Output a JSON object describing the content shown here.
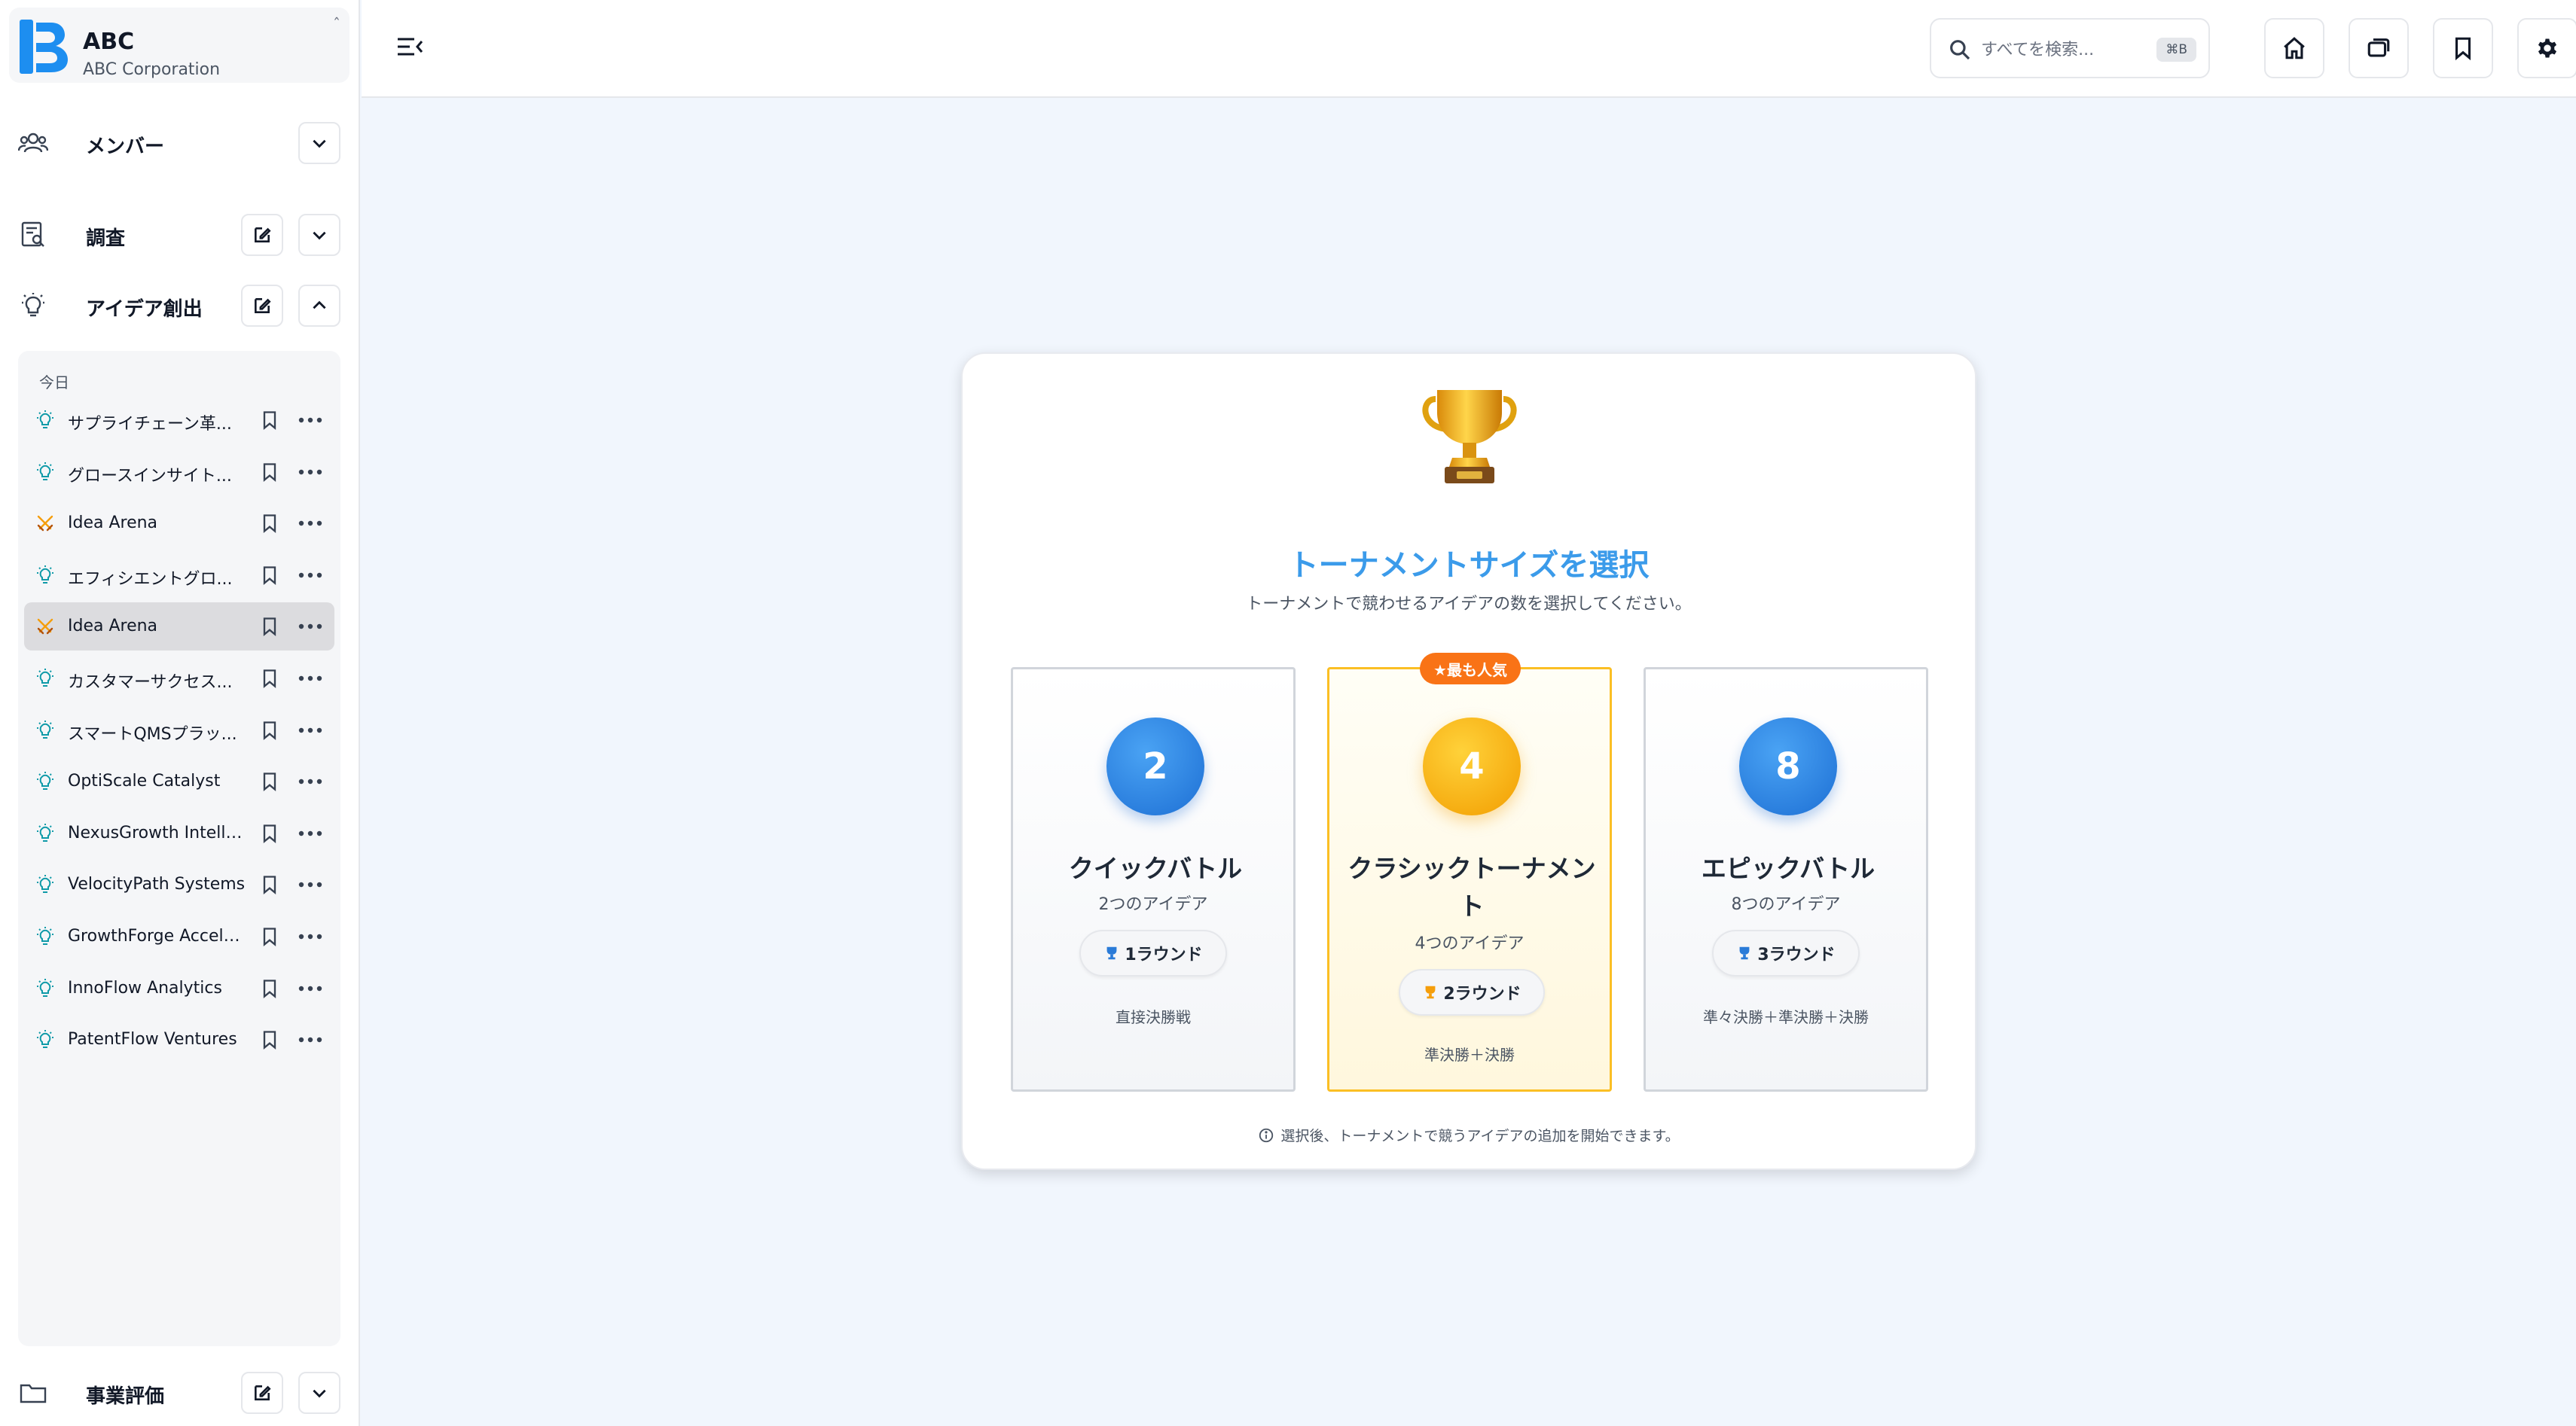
{
  "brand": {
    "name": "ABC",
    "subtitle": "ABC Corporation",
    "logo_letter": "B",
    "color": "#1d8ef0"
  },
  "nav": {
    "members": {
      "label": "メンバー"
    },
    "research": {
      "label": "調査"
    },
    "ideation": {
      "label": "アイデア創出"
    },
    "business_eval": {
      "label": "事業評価"
    }
  },
  "ideas": {
    "group_label": "今日",
    "items": [
      {
        "label": "サプライチェーン革...",
        "icon": "lightbulb-icon"
      },
      {
        "label": "グロースインサイト...",
        "icon": "lightbulb-icon"
      },
      {
        "label": "Idea Arena",
        "icon": "crossed-swords-icon"
      },
      {
        "label": "エフィシエントグロ...",
        "icon": "lightbulb-icon"
      },
      {
        "label": "Idea Arena",
        "icon": "crossed-swords-icon",
        "active": true
      },
      {
        "label": "カスタマーサクセス...",
        "icon": "lightbulb-icon"
      },
      {
        "label": "スマートQMSプラッ...",
        "icon": "lightbulb-icon"
      },
      {
        "label": "OptiScale Catalyst",
        "icon": "lightbulb-icon"
      },
      {
        "label": "NexusGrowth Intellig...",
        "icon": "lightbulb-icon"
      },
      {
        "label": "VelocityPath Systems",
        "icon": "lightbulb-icon"
      },
      {
        "label": "GrowthForge Accele...",
        "icon": "lightbulb-icon"
      },
      {
        "label": "InnoFlow Analytics",
        "icon": "lightbulb-icon"
      },
      {
        "label": "PatentFlow Ventures",
        "icon": "lightbulb-icon"
      }
    ]
  },
  "search": {
    "placeholder": "すべてを検索...",
    "shortcut": "⌘B"
  },
  "card": {
    "title": "トーナメントサイズを選択",
    "subtitle": "トーナメントで競わせるアイデアの数を選択してください。",
    "footer": "選択後、トーナメントで競うアイデアの追加を開始できます。",
    "popular_badge": "★最も人気",
    "options": [
      {
        "number": "2",
        "title": "クイックバトル",
        "count": "2つのアイデア",
        "rounds": "1ラウンド",
        "note": "直接決勝戦"
      },
      {
        "number": "4",
        "title": "クラシックトーナメント",
        "count": "4つのアイデア",
        "rounds": "2ラウンド",
        "note": "準決勝＋決勝"
      },
      {
        "number": "8",
        "title": "エピックバトル",
        "count": "8つのアイデア",
        "rounds": "3ラウンド",
        "note": "準々決勝＋準決勝＋決勝"
      }
    ]
  },
  "colors": {
    "accent": "#3b9bea",
    "gold": "#fbbf24",
    "badge": "#f97316",
    "icon_teal": "#0f9aa8"
  }
}
